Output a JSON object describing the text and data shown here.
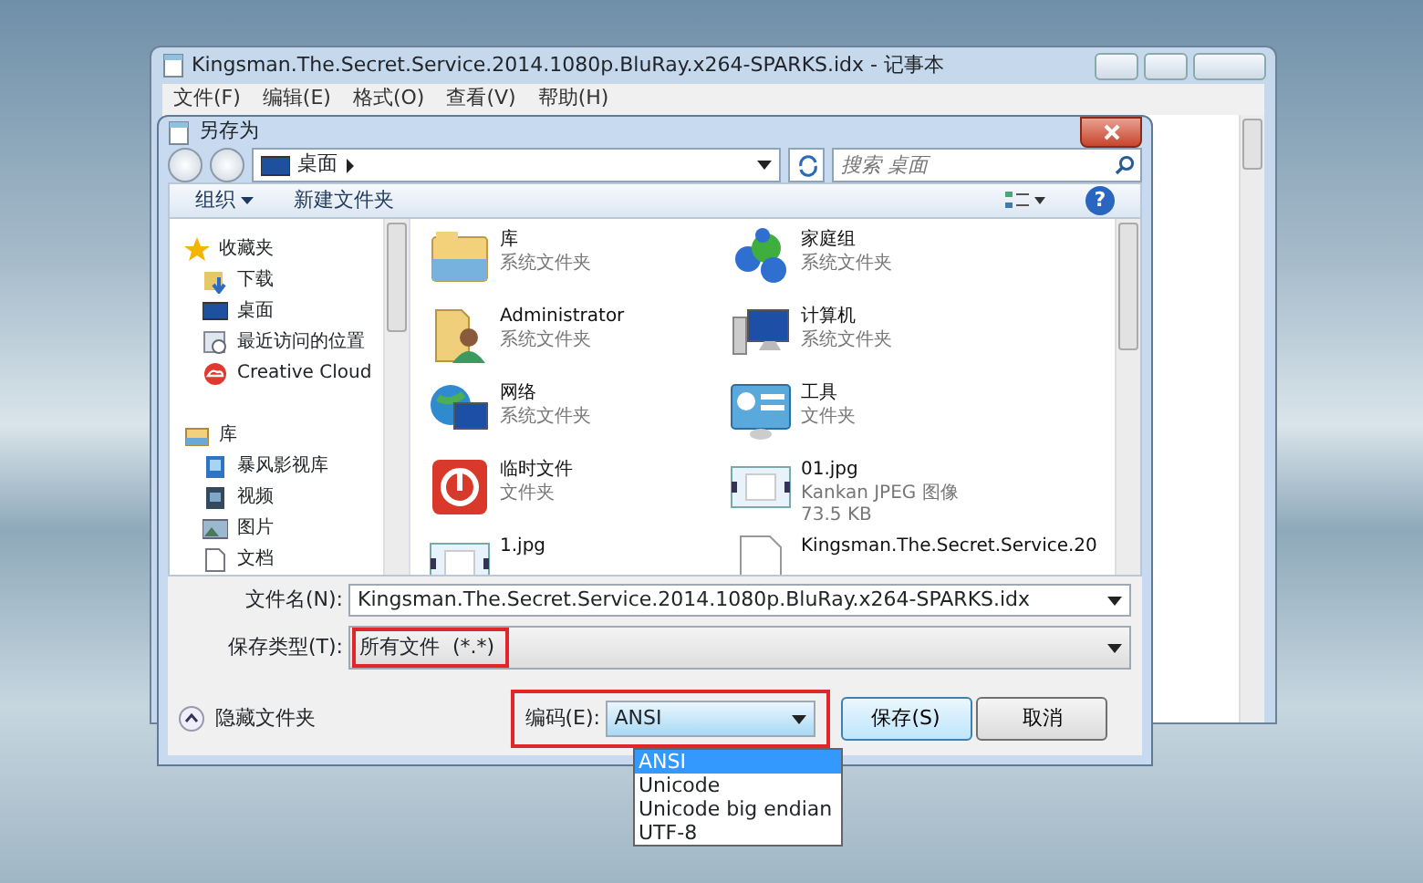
{
  "notepad": {
    "title": "Kingsman.The.Secret.Service.2014.1080p.BluRay.x264-SPARKS.idx - 记事本",
    "menu": [
      "文件(F)",
      "编辑(E)",
      "格式(O)",
      "查看(V)",
      "帮助(H)"
    ]
  },
  "dialog": {
    "title": "另存为",
    "address": "桌面",
    "search": {
      "placeholder": "搜索 桌面"
    },
    "toolbar": [
      "组织",
      "新建文件夹"
    ],
    "help": "?",
    "sidebar": [
      {
        "label": "收藏夹",
        "kind": "star",
        "children": [
          {
            "label": "下载",
            "kind": "download"
          },
          {
            "label": "桌面",
            "kind": "desktop"
          },
          {
            "label": "最近访问的位置",
            "kind": "recent"
          },
          {
            "label": "Creative Cloud",
            "kind": "cloud"
          }
        ]
      },
      {
        "label": "库",
        "kind": "library",
        "children": [
          {
            "label": "暴风影视库",
            "kind": "media"
          },
          {
            "label": "视频",
            "kind": "video"
          },
          {
            "label": "图片",
            "kind": "picture"
          },
          {
            "label": "文档",
            "kind": "document"
          }
        ]
      }
    ],
    "items": [
      {
        "name": "库",
        "kind": "library",
        "lines": [
          "系统文件夹"
        ]
      },
      {
        "name": "家庭组",
        "kind": "homegroup",
        "lines": [
          "系统文件夹"
        ]
      },
      {
        "name": "Administrator",
        "kind": "user",
        "lines": [
          "系统文件夹"
        ]
      },
      {
        "name": "计算机",
        "kind": "computer",
        "lines": [
          "系统文件夹"
        ]
      },
      {
        "name": "网络",
        "kind": "network",
        "lines": [
          "系统文件夹"
        ]
      },
      {
        "name": "工具",
        "kind": "tools",
        "lines": [
          "文件夹"
        ]
      },
      {
        "name": "临时文件",
        "kind": "power",
        "lines": [
          "文件夹"
        ]
      },
      {
        "name": "01.jpg",
        "kind": "image",
        "lines": [
          "Kankan JPEG 图像",
          "73.5 KB"
        ]
      },
      {
        "name": "1.jpg",
        "kind": "image"
      },
      {
        "name": "Kingsman.The.Secret.Service.20",
        "kind": "file"
      }
    ],
    "filename": {
      "label": "文件名(N):",
      "value": "Kingsman.The.Secret.Service.2014.1080p.BluRay.x264-SPARKS.idx"
    },
    "filetype": {
      "label": "保存类型(T):",
      "value": "所有文件  (*.*)",
      "highlighted": true
    },
    "hide_folders": "隐藏文件夹",
    "encoding": {
      "label": "编码(E):",
      "value": "ANSI",
      "highlighted": true,
      "expanded": true,
      "options": [
        {
          "label": "ANSI",
          "selected": true
        },
        {
          "label": "Unicode",
          "selected": false
        },
        {
          "label": "Unicode big endian",
          "selected": false
        },
        {
          "label": "UTF-8",
          "selected": false
        }
      ]
    },
    "buttons": [
      {
        "label": "保存(S)",
        "default": true
      },
      {
        "label": "取消",
        "default": false
      }
    ]
  }
}
